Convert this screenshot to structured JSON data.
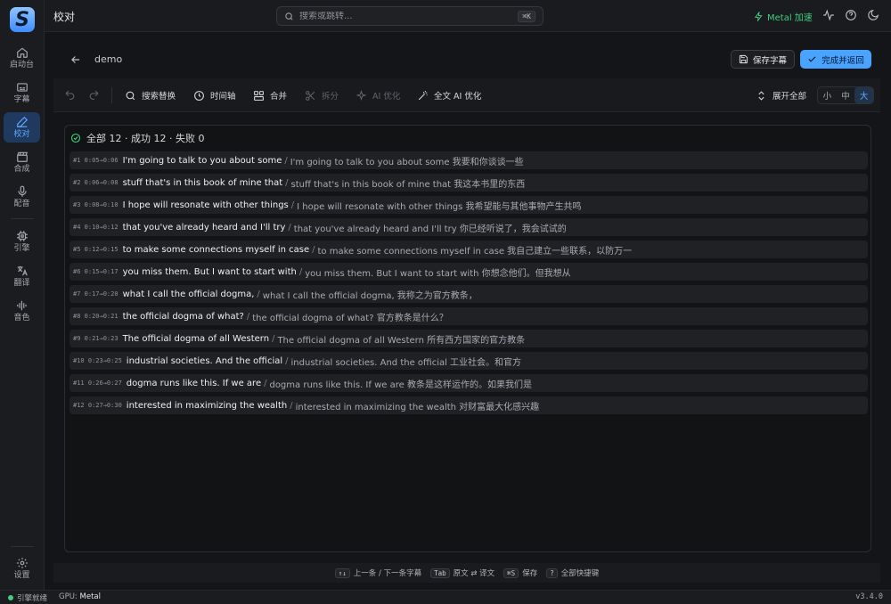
{
  "sidebar": {
    "logo": "S",
    "items": [
      {
        "label": "启动台",
        "icon": "home-icon"
      },
      {
        "label": "字幕",
        "icon": "subtitles-icon"
      },
      {
        "label": "校对",
        "icon": "pen-icon"
      },
      {
        "label": "合成",
        "icon": "clapperboard-icon"
      },
      {
        "label": "配音",
        "icon": "mic-icon"
      },
      {
        "label": "引擎",
        "icon": "cpu-icon"
      },
      {
        "label": "翻译",
        "icon": "translate-icon"
      },
      {
        "label": "音色",
        "icon": "waveform-icon"
      }
    ],
    "settings_label": "设置"
  },
  "topbar": {
    "title": "校对",
    "search_placeholder": "搜索或跳转...",
    "search_shortcut": "⌘K",
    "metal_label": "Metal 加速"
  },
  "header": {
    "doc_name": "demo",
    "save_label": "保存字幕",
    "done_label": "完成并返回"
  },
  "toolbar": {
    "search_replace": "搜索替换",
    "timeline": "时间轴",
    "merge": "合并",
    "split": "拆分",
    "ai_optimize": "AI 优化",
    "full_ai_optimize": "全文 AI 优化",
    "expand_all": "展开全部",
    "sizes": [
      "小",
      "中",
      "大"
    ],
    "active_size": "大"
  },
  "summary": "全部 12 · 成功 12 · 失败 0",
  "segments": [
    {
      "meta": "#1 0:05→0:06",
      "source": "I'm going to talk to you about some",
      "target": "I'm going to talk to you about some 我要和你谈谈一些"
    },
    {
      "meta": "#2 0:06→0:08",
      "source": "stuff that's in this book of mine that",
      "target": "stuff that's in this book of mine that 我这本书里的东西"
    },
    {
      "meta": "#3 0:08→0:10",
      "source": "I hope will resonate with other things",
      "target": "I hope will resonate with other things 我希望能与其他事物产生共鸣"
    },
    {
      "meta": "#4 0:10→0:12",
      "source": "that you've already heard and I'll try",
      "target": "that you've already heard and I'll try 你已经听说了，我会试试的"
    },
    {
      "meta": "#5 0:12→0:15",
      "source": "to make some connections myself in case",
      "target": "to make some connections myself in case 我自己建立一些联系，以防万一"
    },
    {
      "meta": "#6 0:15→0:17",
      "source": "you miss them. But I want to start with",
      "target": "you miss them. But I want to start with 你想念他们。但我想从"
    },
    {
      "meta": "#7 0:17→0:20",
      "source": "what I call the official dogma,",
      "target": "what I call the official dogma, 我称之为官方教条，"
    },
    {
      "meta": "#8 0:20→0:21",
      "source": "the official dogma of what?",
      "target": "the official dogma of what? 官方教条是什么？"
    },
    {
      "meta": "#9 0:21→0:23",
      "source": "The official dogma of all Western",
      "target": "The official dogma of all Western 所有西方国家的官方教条"
    },
    {
      "meta": "#10 0:23→0:25",
      "source": "industrial societies. And the official",
      "target": "industrial societies. And the official 工业社会。和官方"
    },
    {
      "meta": "#11 0:26→0:27",
      "source": "dogma runs like this. If we are",
      "target": "dogma runs like this. If we are 教条是这样运作的。如果我们是"
    },
    {
      "meta": "#12 0:27→0:30",
      "source": "interested in maximizing the wealth",
      "target": "interested in maximizing the wealth 对财富最大化感兴趣"
    }
  ],
  "hints": [
    {
      "key": "↑↓",
      "text": "上一条 / 下一条字幕"
    },
    {
      "key": "Tab",
      "text": "原文 ⇄ 译文"
    },
    {
      "key": "⌘S",
      "text": "保存"
    },
    {
      "key": "?",
      "text": "全部快捷键"
    }
  ],
  "status": {
    "engine": "引擎就绪",
    "gpu_label": "GPU:",
    "gpu_value": "Metal",
    "version": "v3.4.0"
  },
  "colors": {
    "accent": "#4aa3ff",
    "success": "#3fcf7f",
    "background": "#141518"
  }
}
